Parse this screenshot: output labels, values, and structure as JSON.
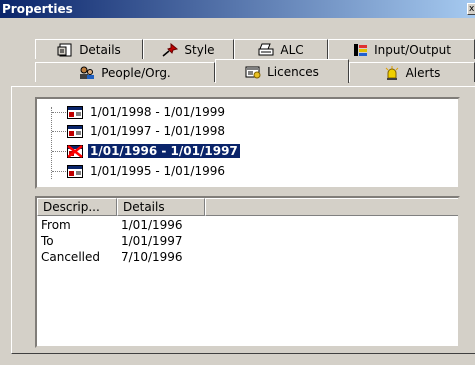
{
  "window": {
    "title": "Properties",
    "close_glyph": "x"
  },
  "tabs": {
    "row1": [
      {
        "label": "Details",
        "icon": "document-properties-icon"
      },
      {
        "label": "Style",
        "icon": "red-pin-icon"
      },
      {
        "label": "ALC",
        "icon": "printer-icon"
      },
      {
        "label": "Input/Output",
        "icon": "input-output-icon"
      }
    ],
    "row2": [
      {
        "label": "People/Org.",
        "icon": "people-icon"
      },
      {
        "label": "Licences",
        "icon": "licence-icon",
        "active": true
      },
      {
        "label": "Alerts",
        "icon": "alert-lamp-icon"
      }
    ]
  },
  "tree": {
    "items": [
      {
        "label": "1/01/1998 - 1/01/1999",
        "cancelled": false,
        "selected": false
      },
      {
        "label": "1/01/1997 - 1/01/1998",
        "cancelled": false,
        "selected": false
      },
      {
        "label": "1/01/1996 - 1/01/1997",
        "cancelled": true,
        "selected": true
      },
      {
        "label": "1/01/1995 - 1/01/1996",
        "cancelled": false,
        "selected": false
      }
    ]
  },
  "details": {
    "columns": [
      "Descrip...",
      "Details"
    ],
    "rows": [
      {
        "desc": "From",
        "value": "1/01/1996"
      },
      {
        "desc": "To",
        "value": "1/01/1997"
      },
      {
        "desc": "Cancelled",
        "value": "7/10/1996"
      }
    ]
  },
  "colors": {
    "title_bar": "#0a246a",
    "selection": "#0a246a",
    "face": "#d4d0c8"
  }
}
